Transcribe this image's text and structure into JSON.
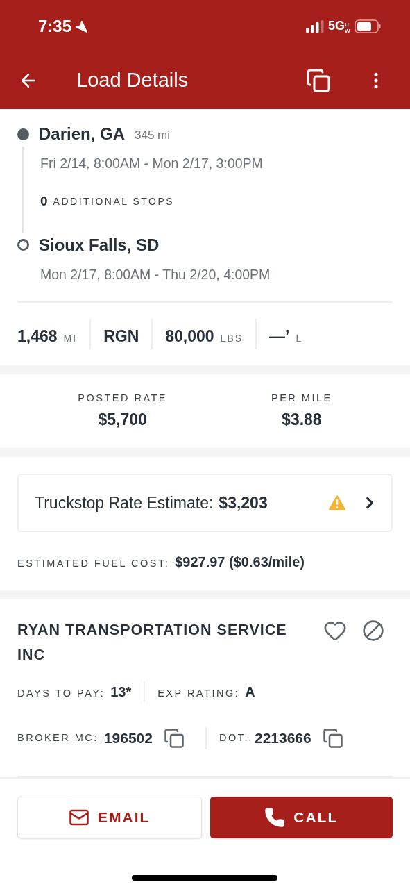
{
  "status_bar": {
    "time": "7:35",
    "network": "5G",
    "network_suffix": "UW"
  },
  "header": {
    "title": "Load Details"
  },
  "route": {
    "stops": [
      {
        "kind": "origin",
        "city": "Darien, GA",
        "distance": "345 mi",
        "window": "Fri 2/14, 8:00AM - Mon 2/17, 3:00PM"
      },
      {
        "kind": "destination",
        "city": "Sioux Falls, SD",
        "window": "Mon 2/17, 8:00AM - Thu 2/20, 4:00PM"
      }
    ],
    "additional_stops": {
      "count": "0",
      "label": "ADDITIONAL STOPS"
    }
  },
  "specs": [
    {
      "value": "1,468",
      "unit": "MI"
    },
    {
      "value": "RGN"
    },
    {
      "value": "80,000",
      "unit": "LBS"
    },
    {
      "value": "—’",
      "unit": "L"
    }
  ],
  "rates": [
    {
      "label": "POSTED RATE",
      "value": "$5,700"
    },
    {
      "label": "PER MILE",
      "value": "$3.88"
    }
  ],
  "estimate": {
    "label": "Truckstop Rate Estimate:",
    "value": "$3,203",
    "warning": true
  },
  "fuel": {
    "label": "ESTIMATED FUEL COST:",
    "value": "$927.97 ($0.63/mile)"
  },
  "company": {
    "name": "RYAN TRANSPORTATION SERVICE INC",
    "favorite": false,
    "stats": [
      {
        "label": "DAYS TO PAY:",
        "value": "13*"
      },
      {
        "label": "EXP RATING:",
        "value": "A"
      }
    ],
    "ids": [
      {
        "label": "BROKER MC:",
        "value": "196502"
      },
      {
        "label": "DOT:",
        "value": "2213666"
      }
    ]
  },
  "actions": [
    {
      "kind": "email",
      "label": "EMAIL"
    },
    {
      "kind": "call",
      "label": "CALL"
    }
  ]
}
